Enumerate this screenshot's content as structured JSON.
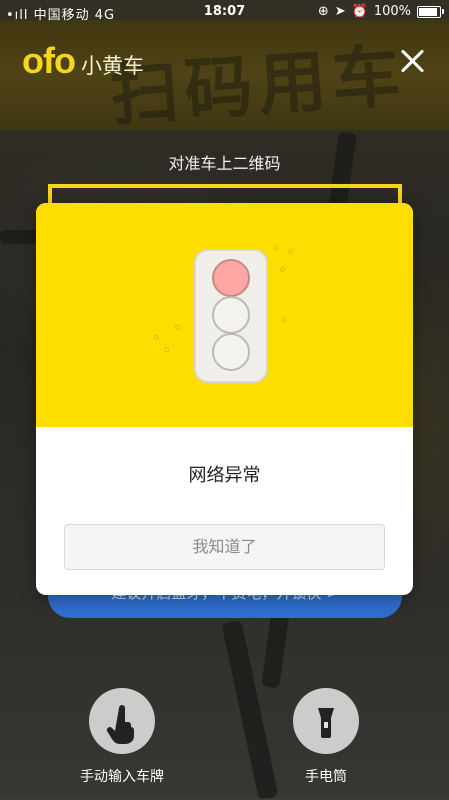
{
  "status_bar": {
    "carrier": "•ıll 中国移动 4G",
    "time": "18:07",
    "battery": "100%",
    "battery_level": 1.0
  },
  "header": {
    "logo_text": "ofo",
    "logo_subtitle": "小黄车",
    "close_icon": "close-icon"
  },
  "scanner": {
    "hint": "对准车上二维码",
    "background_text": "扫码用车",
    "banner_text": "建议开启蓝牙，不费电，开锁快 >"
  },
  "modal": {
    "illustration": "traffic-light-icon",
    "message": "网络异常",
    "button_label": "我知道了"
  },
  "controls": [
    {
      "label": "手动输入车牌",
      "icon": "hand-pointer-icon"
    },
    {
      "label": "手电筒",
      "icon": "flashlight-icon"
    }
  ],
  "colors": {
    "brand_yellow": "#fedd00",
    "lamp_red": "#ffa7a5",
    "banner_blue": "#2f6fd1"
  }
}
